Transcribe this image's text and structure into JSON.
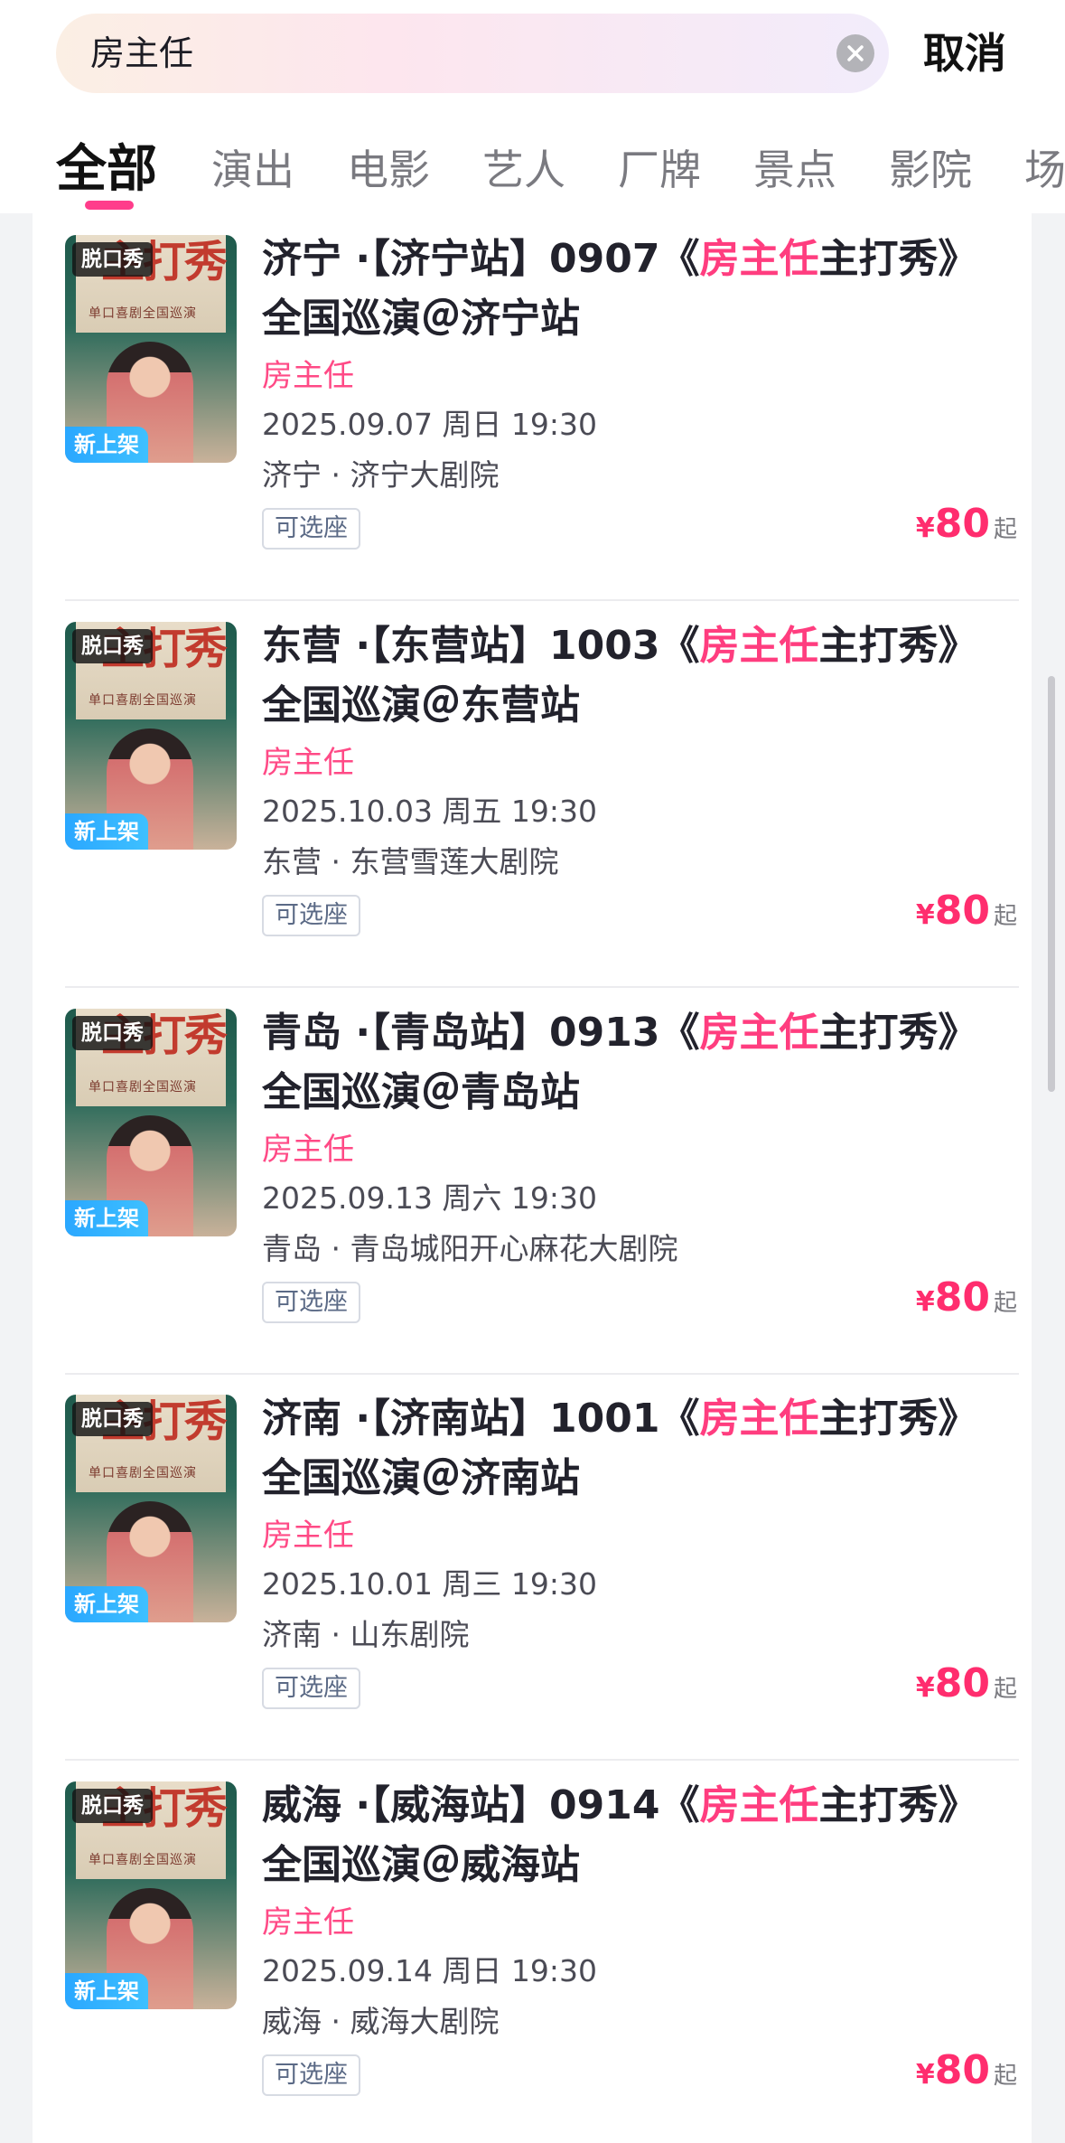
{
  "search": {
    "query": "房主任",
    "cancel_label": "取消"
  },
  "tabs": [
    "全部",
    "演出",
    "电影",
    "艺人",
    "厂牌",
    "景点",
    "影院",
    "场"
  ],
  "active_tab": 0,
  "colors": {
    "accent": "#ff3d7f",
    "new_tag": "#2aa7ff"
  },
  "results": [
    {
      "genre_tag": "脱口秀",
      "new_tag": "新上架",
      "poster_text_big": "主打秀",
      "poster_text_small": "单口喜剧全国巡演",
      "title_before": "济宁 ·【济宁站】0907《",
      "title_highlight": "房主任",
      "title_after": "主打秀》全国巡演＠济宁站",
      "artist": "房主任",
      "date": "2025.09.07 周日 19:30",
      "venue": "济宁 · 济宁大剧院",
      "badge": "可选座",
      "price_currency": "¥",
      "price": "80",
      "price_suffix": "起"
    },
    {
      "genre_tag": "脱口秀",
      "new_tag": "新上架",
      "poster_text_big": "主打秀",
      "poster_text_small": "单口喜剧全国巡演",
      "title_before": "东营 ·【东营站】1003《",
      "title_highlight": "房主任",
      "title_after": "主打秀》全国巡演＠东营站",
      "artist": "房主任",
      "date": "2025.10.03 周五 19:30",
      "venue": "东营 · 东营雪莲大剧院",
      "badge": "可选座",
      "price_currency": "¥",
      "price": "80",
      "price_suffix": "起"
    },
    {
      "genre_tag": "脱口秀",
      "new_tag": "新上架",
      "poster_text_big": "主打秀",
      "poster_text_small": "单口喜剧全国巡演",
      "title_before": "青岛 ·【青岛站】0913《",
      "title_highlight": "房主任",
      "title_after": "主打秀》全国巡演＠青岛站",
      "artist": "房主任",
      "date": "2025.09.13 周六 19:30",
      "venue": "青岛 · 青岛城阳开心麻花大剧院",
      "badge": "可选座",
      "price_currency": "¥",
      "price": "80",
      "price_suffix": "起"
    },
    {
      "genre_tag": "脱口秀",
      "new_tag": "新上架",
      "poster_text_big": "主打秀",
      "poster_text_small": "单口喜剧全国巡演",
      "title_before": "济南 ·【济南站】1001《",
      "title_highlight": "房主任",
      "title_after": "主打秀》全国巡演＠济南站",
      "artist": "房主任",
      "date": "2025.10.01 周三 19:30",
      "venue": "济南 · 山东剧院",
      "badge": "可选座",
      "price_currency": "¥",
      "price": "80",
      "price_suffix": "起"
    },
    {
      "genre_tag": "脱口秀",
      "new_tag": "新上架",
      "poster_text_big": "主打秀",
      "poster_text_small": "单口喜剧全国巡演",
      "title_before": "威海 ·【威海站】0914《",
      "title_highlight": "房主任",
      "title_after": "主打秀》全国巡演＠威海站",
      "artist": "房主任",
      "date": "2025.09.14 周日 19:30",
      "venue": "威海 · 威海大剧院",
      "badge": "可选座",
      "price_currency": "¥",
      "price": "80",
      "price_suffix": "起"
    }
  ]
}
